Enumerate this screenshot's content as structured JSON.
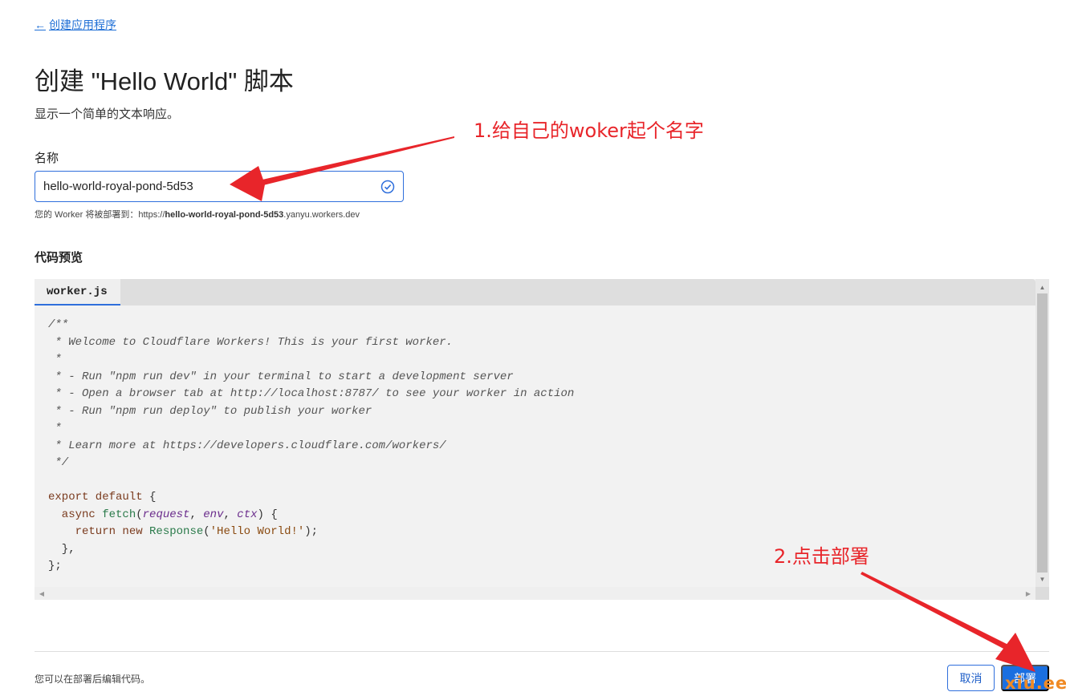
{
  "nav": {
    "back_label": "创建应用程序",
    "back_icon": "arrow-left-icon"
  },
  "page": {
    "title": "创建 \"Hello World\" 脚本",
    "subtitle": "显示一个简单的文本响应。"
  },
  "form": {
    "name_label": "名称",
    "name_value": "hello-world-royal-pond-5d53",
    "name_valid_icon": "check-circle-icon",
    "deploy_hint_prefix": "您的 Worker 将被部署到：https://",
    "deploy_hint_bold": "hello-world-royal-pond-5d53",
    "deploy_hint_suffix": ".yanyu.workers.dev"
  },
  "preview": {
    "label": "代码预览",
    "tab": "worker.js",
    "code": {
      "c1": "/**",
      "c2": " * Welcome to Cloudflare Workers! This is your first worker.",
      "c3": " *",
      "c4": " * - Run \"npm run dev\" in your terminal to start a development server",
      "c5": " * - Open a browser tab at http://localhost:8787/ to see your worker in action",
      "c6": " * - Run \"npm run deploy\" to publish your worker",
      "c7": " *",
      "c8": " * Learn more at https://developers.cloudflare.com/workers/",
      "c9": " */",
      "l1_kw": "export default",
      "l1_rest": " {",
      "l2_kw": "  async ",
      "l2_fn": "fetch",
      "l2_open": "(",
      "l2_p1": "request",
      "l2_sep1": ", ",
      "l2_p2": "env",
      "l2_sep2": ", ",
      "l2_p3": "ctx",
      "l2_close": ") {",
      "l3_kw": "    return new ",
      "l3_fn": "Response",
      "l3_open": "(",
      "l3_str": "'Hello World!'",
      "l3_close": ");",
      "l4": "  },",
      "l5": "};"
    }
  },
  "footer": {
    "note": "您可以在部署后编辑代码。",
    "cancel_label": "取消",
    "deploy_label": "部署"
  },
  "annotations": {
    "step1": "1.给自己的woker起个名字",
    "step2": "2.点击部署",
    "color": "#e8252a"
  },
  "watermark": "xiu.ee",
  "colors": {
    "accent": "#1a6fe0",
    "annotation": "#e8252a",
    "watermark": "#f08a24"
  }
}
